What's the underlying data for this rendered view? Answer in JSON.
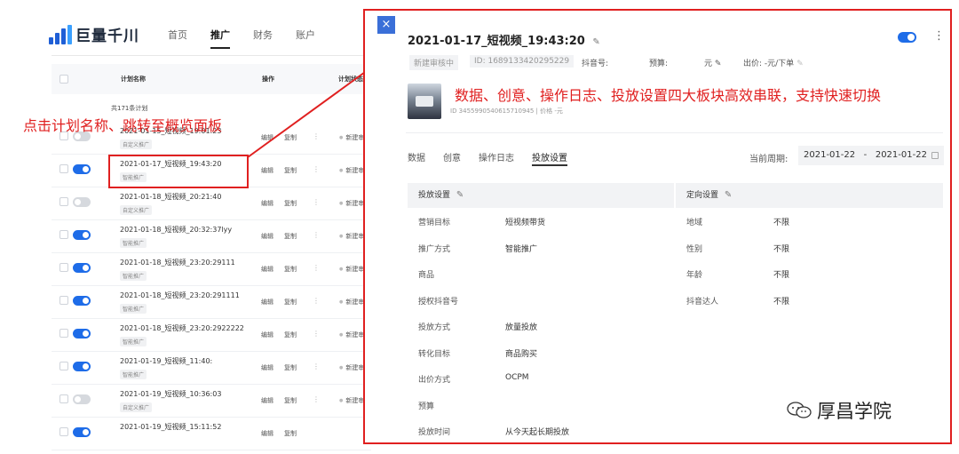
{
  "app": {
    "logo_text": "巨量千川",
    "nav": [
      "首页",
      "推广",
      "财务",
      "账户"
    ],
    "nav_active": 1
  },
  "table": {
    "headers": {
      "name": "计划名称",
      "ops": "操作",
      "status": "计划状态"
    },
    "count_text": "共171条计划",
    "rows": [
      {
        "name": "2021-01-15_短视频_19:01:23",
        "tag": "自定义推广",
        "on": false,
        "edit": "编辑",
        "copy": "复制",
        "more": "⋮",
        "status": "新建审核中"
      },
      {
        "name": "2021-01-17_短视频_19:43:20",
        "tag": "智能推广",
        "on": true,
        "edit": "编辑",
        "copy": "复制",
        "more": "⋮",
        "status": "新建审核中"
      },
      {
        "name": "2021-01-18_短视频_20:21:40",
        "tag": "自定义推广",
        "on": false,
        "edit": "编辑",
        "copy": "复制",
        "more": "⋮",
        "status": "新建审核中"
      },
      {
        "name": "2021-01-18_短视频_20:32:37lyy",
        "tag": "智能推广",
        "on": true,
        "edit": "编辑",
        "copy": "复制",
        "more": "⋮",
        "status": "新建审核中"
      },
      {
        "name": "2021-01-18_短视频_23:20:29111",
        "tag": "智能推广",
        "on": true,
        "edit": "编辑",
        "copy": "复制",
        "more": "⋮",
        "status": "新建审核中"
      },
      {
        "name": "2021-01-18_短视频_23:20:291111",
        "tag": "智能推广",
        "on": true,
        "edit": "编辑",
        "copy": "复制",
        "more": "⋮",
        "status": "新建审核中"
      },
      {
        "name": "2021-01-18_短视频_23:20:2922222",
        "tag": "智能推广",
        "on": true,
        "edit": "编辑",
        "copy": "复制",
        "more": "⋮",
        "status": "新建审核中"
      },
      {
        "name": "2021-01-19_短视频_11:40:",
        "tag": "智能推广",
        "on": true,
        "edit": "编辑",
        "copy": "复制",
        "more": "⋮",
        "status": "新建审核中"
      },
      {
        "name": "2021-01-19_短视频_10:36:03",
        "tag": "自定义推广",
        "on": false,
        "edit": "编辑",
        "copy": "复制",
        "more": "⋮",
        "status": "新建审核中"
      },
      {
        "name": "2021-01-19_短视频_15:11:52",
        "tag": "",
        "on": true,
        "edit": "编辑",
        "copy": "复制",
        "more": "",
        "status": ""
      }
    ]
  },
  "annotation": {
    "left_callout": "点击计划名称、跳转至概览面板",
    "banner": "数据、创意、操作日志、投放设置四大板块高效串联，支持快速切换"
  },
  "panel": {
    "close": "×",
    "title": "2021-01-17_短视频_19:43:20",
    "more": "⋮",
    "meta": {
      "status_chip": "新建审核中",
      "id": "ID: 1689133420295229",
      "douyin_label": "抖音号:",
      "budget_label": "预算:",
      "budget_value": "元",
      "bid": "出价: -元/下单"
    },
    "product_sub": "ID 3455990540615710945  |  价格 -元",
    "tabs": [
      "数据",
      "创意",
      "操作日志",
      "投放设置"
    ],
    "active_tab": 3,
    "period_label": "当前周期:",
    "period_start": "2021-01-22",
    "period_sep": "-",
    "period_end": "2021-01-22",
    "delivery": {
      "title": "投放设置",
      "items": [
        {
          "k": "营销目标",
          "v": "短视频带货"
        },
        {
          "k": "推广方式",
          "v": "智能推广"
        },
        {
          "k": "商品",
          "v": ""
        },
        {
          "k": "授权抖音号",
          "v": ""
        },
        {
          "k": "投放方式",
          "v": "放量投放"
        },
        {
          "k": "转化目标",
          "v": "商品购买"
        },
        {
          "k": "出价方式",
          "v": "OCPM"
        },
        {
          "k": "预算",
          "v": ""
        },
        {
          "k": "投放时间",
          "v": "从今天起长期投放"
        }
      ]
    },
    "targeting": {
      "title": "定向设置",
      "items": [
        {
          "k": "地域",
          "v": "不限"
        },
        {
          "k": "性别",
          "v": "不限"
        },
        {
          "k": "年龄",
          "v": "不限"
        },
        {
          "k": "抖音达人",
          "v": "不限"
        }
      ]
    }
  },
  "watermark": "厚昌学院",
  "colors": {
    "accent": "#1e6ce8",
    "annotation": "#e02020"
  }
}
